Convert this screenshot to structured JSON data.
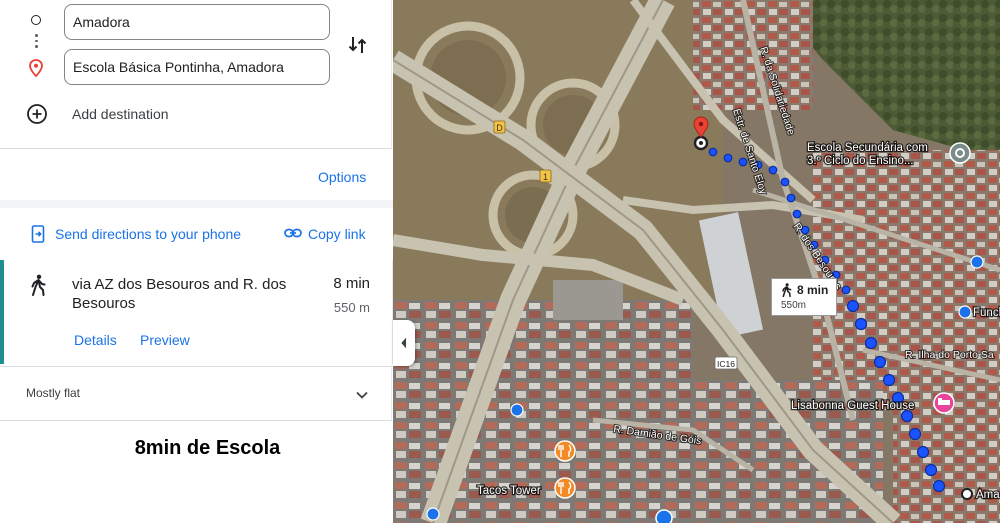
{
  "directions": {
    "origin_value": "Amadora",
    "destination_value": "Escola Básica Pontinha, Amadora",
    "add_destination_label": "Add destination",
    "options_label": "Options",
    "send_to_phone_label": "Send directions to your phone",
    "copy_link_label": "Copy link"
  },
  "route": {
    "via": "via AZ dos Besouros and R. dos Besouros",
    "duration": "8 min",
    "distance": "550 m",
    "details_label": "Details",
    "preview_label": "Preview",
    "terrain": "Mostly flat"
  },
  "caption": "8min de Escola",
  "map": {
    "eta_duration": "8 min",
    "eta_distance": "550m",
    "labels": {
      "street_solidariedade": "R. da Solidariedade",
      "estr_santo_eloy": "Estr. de Santo Eloy",
      "school_line1": "Escola Secundária com",
      "school_line2": "3.º Ciclo do Ensino...",
      "r_besouros": "R. dos Besouros",
      "r_ilha_porto_santo": "R. Ilha do Porto Sa",
      "guest_house": "Lisabonna Guest House",
      "r_damiao_gois": "R. Damião de Góis",
      "tacos_tower": "Tacos Tower",
      "funch": "Funch",
      "ama": "Ama",
      "ic16": "IC16",
      "road_d": "D",
      "road_1": "1"
    }
  },
  "colors": {
    "accent_blue": "#1a73e8",
    "route_dot_blue": "#1a53ff",
    "selected_route_bar": "#1e8e8e",
    "pin_red": "#ea4335",
    "restaurant_orange": "#f28b27",
    "hotel_pink": "#e8449a"
  }
}
